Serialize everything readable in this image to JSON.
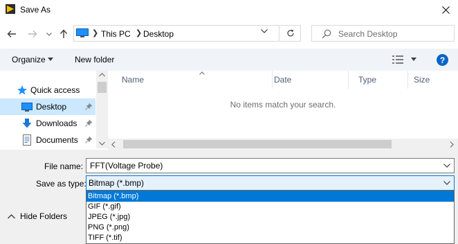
{
  "window": {
    "title": "Save As",
    "close_icon": "close-icon",
    "app_icon": "labview-app-icon"
  },
  "address": {
    "crumbs": [
      "This PC",
      "Desktop"
    ],
    "search_placeholder": "Search Desktop"
  },
  "toolbar": {
    "organize_label": "Organize",
    "new_folder_label": "New folder",
    "help_label": "?"
  },
  "nav": {
    "items": [
      {
        "label": "Quick access",
        "icon": "star-icon"
      },
      {
        "label": "Desktop",
        "icon": "desktop-icon",
        "selected": true
      },
      {
        "label": "Downloads",
        "icon": "download-arrow-icon"
      },
      {
        "label": "Documents",
        "icon": "document-icon"
      }
    ]
  },
  "filelist": {
    "columns": [
      "Name",
      "Date",
      "Type",
      "Size"
    ],
    "empty_message": "No items match your search."
  },
  "form": {
    "file_name_label": "File name:",
    "file_name_value": "FFT(Voltage Probe)",
    "save_as_type_label": "Save as type:",
    "save_as_type_value": "Bitmap (*.bmp)",
    "type_options": [
      "Bitmap (*.bmp)",
      "GIF (*.gif)",
      "JPEG (*.jpg)",
      "PNG (*.png)",
      "TIFF (*.tif)"
    ],
    "selected_option_index": 0,
    "hide_folders_label": "Hide Folders"
  },
  "colors": {
    "accent": "#0078d7",
    "selection_bg": "#cce8ff",
    "command_bar_bg": "#f0f4f9",
    "form_bg": "#f0f0f0",
    "help_icon": "#0a64c8"
  }
}
